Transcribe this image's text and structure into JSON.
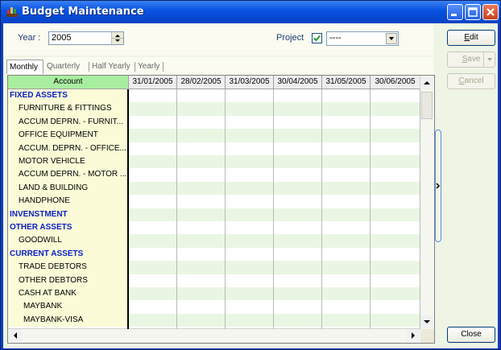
{
  "window": {
    "title": "Budget Maintenance"
  },
  "filters": {
    "year_label": "Year :",
    "year_value": "2005",
    "project_label": "Project",
    "project_checked": true,
    "project_value": "----"
  },
  "tabs": [
    {
      "label": "Monthly",
      "active": true
    },
    {
      "label": "Quarterly",
      "active": false
    },
    {
      "label": "Half Yearly",
      "active": false
    },
    {
      "label": "Yearly",
      "active": false
    }
  ],
  "grid": {
    "account_header": "Account",
    "columns": [
      "31/01/2005",
      "28/02/2005",
      "31/03/2005",
      "30/04/2005",
      "31/05/2005",
      "30/06/2005"
    ],
    "rows": [
      {
        "label": "FIXED ASSETS",
        "type": "group"
      },
      {
        "label": "FURNITURE & FITTINGS",
        "type": "item"
      },
      {
        "label": "ACCUM DEPRN. - FURNIT...",
        "type": "item"
      },
      {
        "label": "OFFICE EQUIPMENT",
        "type": "item"
      },
      {
        "label": "ACCUM. DEPRN. - OFFICE...",
        "type": "item"
      },
      {
        "label": "MOTOR VEHICLE",
        "type": "item"
      },
      {
        "label": "ACCUM DEPRN. - MOTOR ...",
        "type": "item"
      },
      {
        "label": "LAND & BUILDING",
        "type": "item"
      },
      {
        "label": "HANDPHONE",
        "type": "item"
      },
      {
        "label": "INVENSTMENT",
        "type": "group"
      },
      {
        "label": "OTHER ASSETS",
        "type": "group"
      },
      {
        "label": "GOODWILL",
        "type": "item"
      },
      {
        "label": "CURRENT ASSETS",
        "type": "group"
      },
      {
        "label": "TRADE DEBTORS",
        "type": "item"
      },
      {
        "label": "OTHER DEBTORS",
        "type": "item"
      },
      {
        "label": "CASH AT BANK",
        "type": "item"
      },
      {
        "label": "MAYBANK",
        "type": "sub"
      },
      {
        "label": "MAYBANK-VISA",
        "type": "sub"
      }
    ]
  },
  "buttons": {
    "edit": "Edit",
    "save": "Save",
    "cancel": "Cancel",
    "close": "Close"
  },
  "colors": {
    "group_text": "#0a1ec8",
    "account_bg": "#fbfbd8",
    "stripe": "#e9f7e2",
    "header_account_bg": "#a8eea0"
  }
}
